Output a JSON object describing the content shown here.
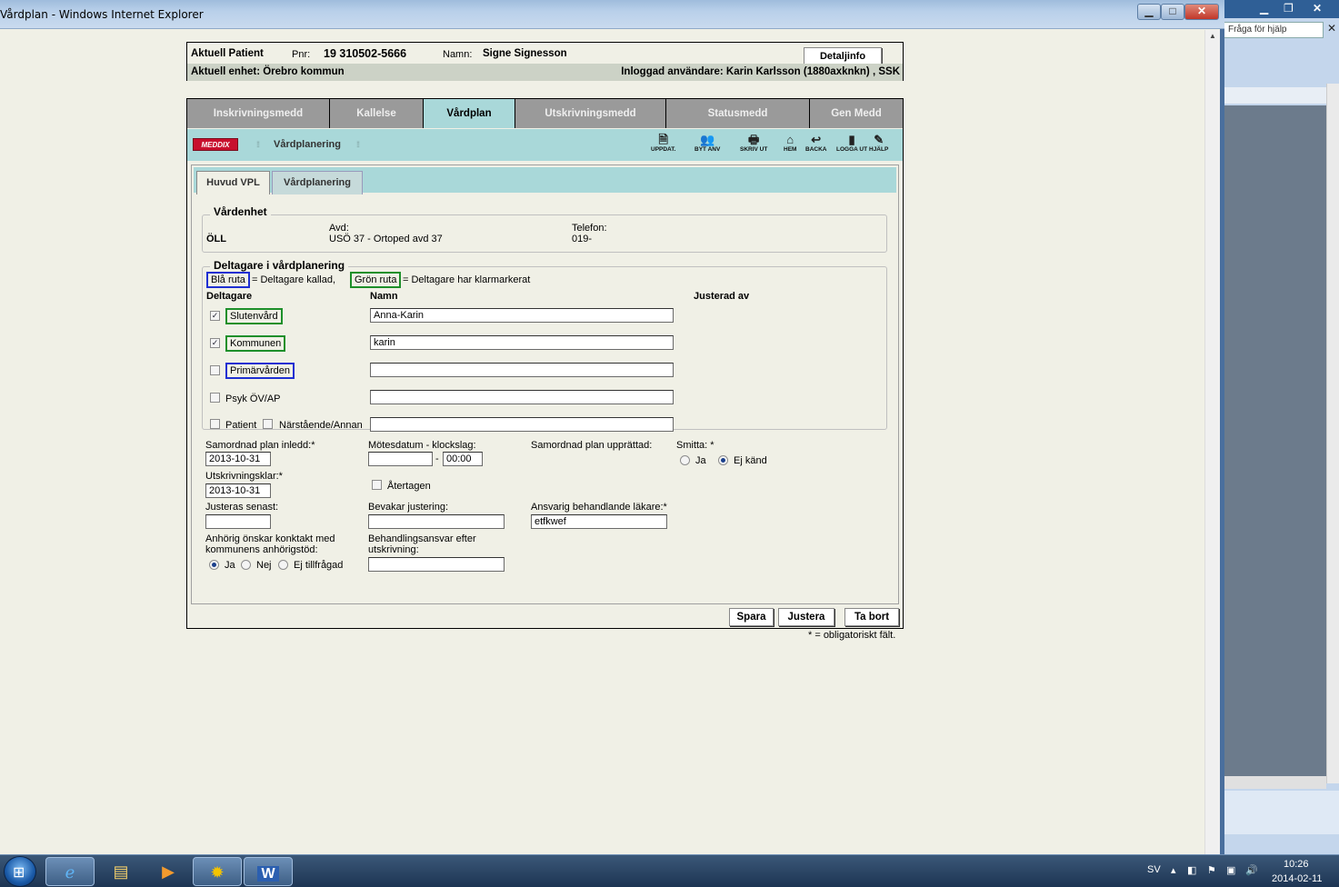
{
  "window": {
    "title": "Vårdplan - Windows Internet Explorer"
  },
  "background_window": {
    "help_placeholder": "Fråga för hjälp"
  },
  "patient_header": {
    "label_current": "Aktuell Patient",
    "pnr_label": "Pnr:",
    "pnr_value": "19 310502-5666",
    "name_label": "Namn:",
    "name_value": "Signe Signesson",
    "detail_button": "Detaljinfo",
    "unit": "Aktuell enhet: Örebro kommun",
    "user": "Inloggad användare: Karin Karlsson (1880axknkn) , SSK"
  },
  "main_tabs": [
    {
      "label": "Inskrivningsmedd",
      "active": false
    },
    {
      "label": "Kallelse",
      "active": false
    },
    {
      "label": "Vårdplan",
      "active": true
    },
    {
      "label": "Utskrivningsmedd",
      "active": false
    },
    {
      "label": "Statusmedd",
      "active": false
    },
    {
      "label": "Gen Medd",
      "active": false
    }
  ],
  "toolbar": {
    "logo": "MEDDIX",
    "title": "Vårdplanering",
    "buttons": [
      {
        "label": "UPPDAT.",
        "icon": "refresh-icon"
      },
      {
        "label": "BYT ANV",
        "icon": "switch-user-icon"
      },
      {
        "label": "SKRIV UT",
        "icon": "printer-icon"
      },
      {
        "label": "HEM",
        "icon": "home-icon"
      },
      {
        "label": "BACKA",
        "icon": "back-icon"
      },
      {
        "label": "LOGGA UT",
        "icon": "logout-icon"
      },
      {
        "label": "HJÄLP",
        "icon": "help-icon"
      }
    ]
  },
  "sub_tabs": [
    {
      "label": "Huvud VPL",
      "active": true
    },
    {
      "label": "Vårdplanering",
      "active": false
    }
  ],
  "vardenhet": {
    "legend": "Vårdenhet",
    "unit_code": "ÖLL",
    "avd_label": "Avd:",
    "avd_value": "USÖ 37 - Ortoped avd 37",
    "telefon_label": "Telefon:",
    "telefon_value": "019-"
  },
  "deltagare": {
    "legend": "Deltagare i vårdplanering",
    "legend_blue": "Blå ruta",
    "legend_blue_text": "= Deltagare kallad,",
    "legend_green": "Grön ruta",
    "legend_green_text": "= Deltagare har klarmarkerat",
    "col_deltagare": "Deltagare",
    "col_namn": "Namn",
    "col_justerad": "Justerad av",
    "rows": [
      {
        "label": "Slutenvård",
        "checked": true,
        "box": "green",
        "name": "Anna-Karin"
      },
      {
        "label": "Kommunen",
        "checked": true,
        "box": "green",
        "name": "karin"
      },
      {
        "label": "Primärvården",
        "checked": false,
        "box": "blue",
        "name": ""
      },
      {
        "label": "Psyk ÖV/AP",
        "checked": false,
        "box": "none",
        "name": ""
      }
    ],
    "patient_label": "Patient",
    "narstaende_label": "Närstående/Annan",
    "patient_name": ""
  },
  "form": {
    "samordnad_inledd_label": "Samordnad plan inledd:*",
    "samordnad_inledd_value": "2013-10-31",
    "motesdatum_label": "Mötesdatum - klockslag:",
    "motesdatum_value": "",
    "klockslag_value": "00:00",
    "samordnad_upprattad_label": "Samordnad plan upprättad:",
    "smitta_label": "Smitta: *",
    "smitta_ja": "Ja",
    "smitta_ej_kand": "Ej känd",
    "utskrivningsklar_label": "Utskrivningsklar:*",
    "utskrivningsklar_value": "2013-10-31",
    "atertagen_label": "Återtagen",
    "justeras_senast_label": "Justeras senast:",
    "justeras_senast_value": "",
    "bevakar_label": "Bevakar justering:",
    "bevakar_value": "",
    "ansvarig_label": "Ansvarig behandlande läkare:*",
    "ansvarig_value": "etfkwef",
    "anhorig_label_1": "Anhörig önskar konktakt med",
    "anhorig_label_2": "kommunens anhörigstöd:",
    "anhorig_ja": "Ja",
    "anhorig_nej": "Nej",
    "anhorig_ej": "Ej tillfrågad",
    "behandlingsansvar_label_1": "Behandlingsansvar efter",
    "behandlingsansvar_label_2": "utskrivning:",
    "behandlingsansvar_value": ""
  },
  "actions": {
    "spara": "Spara",
    "justera": "Justera",
    "ta_bort": "Ta bort"
  },
  "mandatory_note": "* = obligatoriskt fält.",
  "taskbar": {
    "language": "SV",
    "time": "10:26",
    "date": "2014-02-11"
  }
}
